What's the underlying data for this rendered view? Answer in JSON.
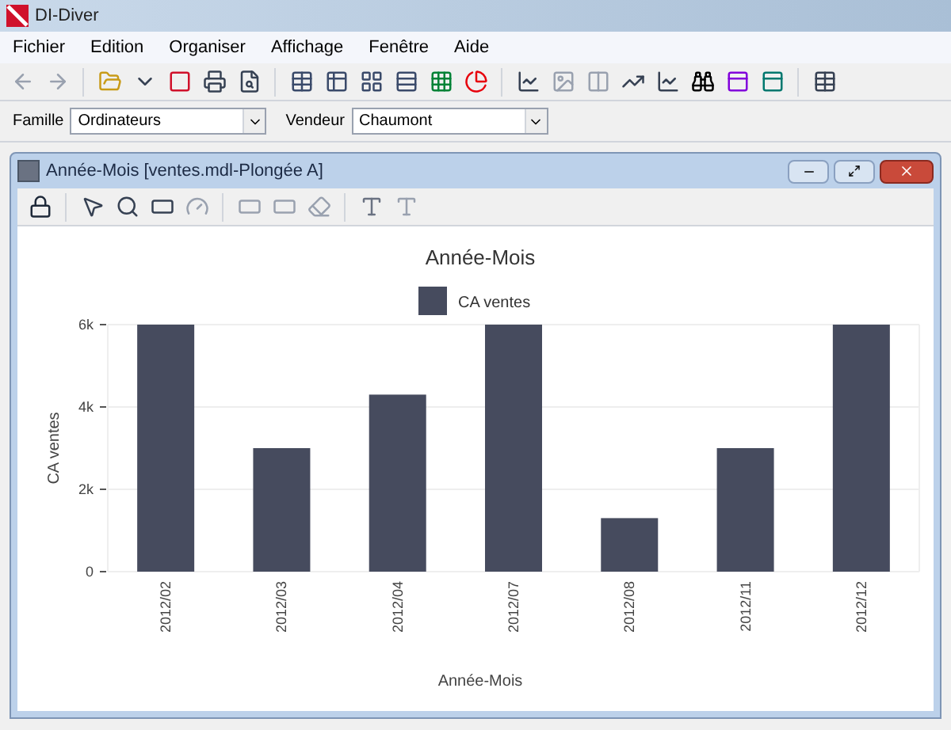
{
  "window": {
    "title": "DI-Diver"
  },
  "menu": [
    "Fichier",
    "Edition",
    "Organiser",
    "Affichage",
    "Fenêtre",
    "Aide"
  ],
  "filters": [
    {
      "label": "Famille",
      "value": "Ordinateurs"
    },
    {
      "label": "Vendeur",
      "value": "Chaumont"
    }
  ],
  "child_window": {
    "title": "Année-Mois [ventes.mdl-Plongée A]",
    "chart_data": {
      "type": "bar",
      "title": "Année-Mois",
      "xlabel": "Année-Mois",
      "ylabel": "CA ventes",
      "categories": [
        "2012/02",
        "2012/03",
        "2012/04",
        "2012/07",
        "2012/08",
        "2012/11",
        "2012/12"
      ],
      "series": [
        {
          "name": "CA ventes",
          "color": "#464b5e",
          "values": [
            6000,
            3000,
            4300,
            6000,
            1300,
            3000,
            6000
          ]
        }
      ],
      "ylim": [
        0,
        6000
      ],
      "yticks": [
        {
          "value": 0,
          "label": "0"
        },
        {
          "value": 2000,
          "label": "2k"
        },
        {
          "value": 4000,
          "label": "4k"
        },
        {
          "value": 6000,
          "label": "6k"
        }
      ]
    }
  }
}
